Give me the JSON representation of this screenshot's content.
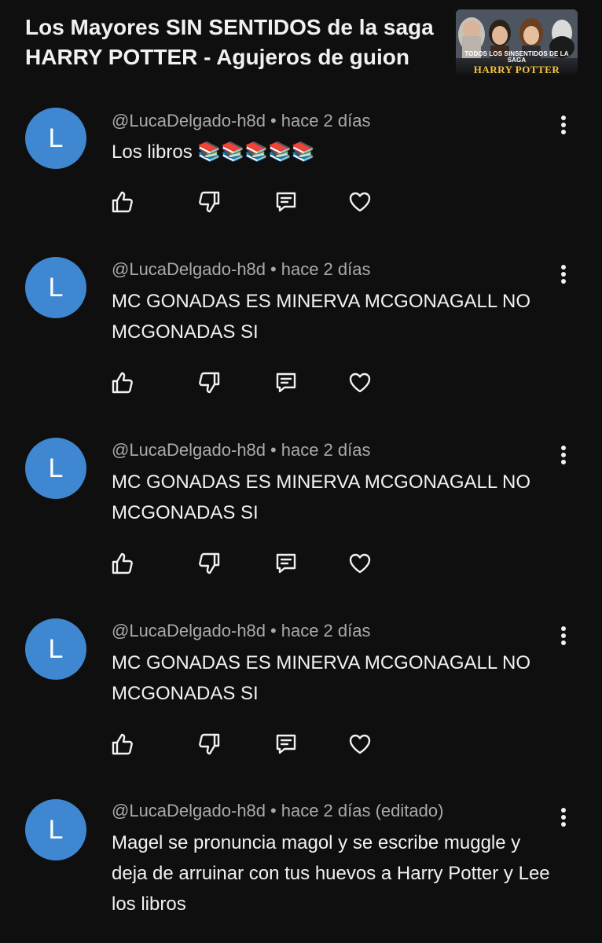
{
  "header": {
    "video_title": "Los Mayores SIN SENTIDOS de la saga HARRY POTTER - Agujeros de guion",
    "thumbnail": {
      "caption_small": "TODOS LOS SINSENTIDOS DE LA SAGA",
      "caption_big": "HARRY POTTER"
    }
  },
  "icons": {
    "like": "thumbs-up-icon",
    "dislike": "thumbs-down-icon",
    "reply": "reply-comment-icon",
    "heart": "heart-icon",
    "menu": "more-vertical-icon"
  },
  "colors": {
    "background": "#0f0f0f",
    "avatar": "#3f88d1",
    "meta_text": "#aaaaaa",
    "body_text": "#f1f1f1",
    "thumb_caption": "#f5c242"
  },
  "comments": [
    {
      "avatar_letter": "L",
      "author": "@LucaDelgado-h8d",
      "time": "hace 2 días",
      "text": "Los libros 📚📚📚📚📚"
    },
    {
      "avatar_letter": "L",
      "author": "@LucaDelgado-h8d",
      "time": "hace 2 días",
      "text": "MC GONADAS ES MINERVA MCGONAGALL NO MCGONADAS SI"
    },
    {
      "avatar_letter": "L",
      "author": "@LucaDelgado-h8d",
      "time": "hace 2 días",
      "text": "MC GONADAS ES MINERVA MCGONAGALL NO MCGONADAS SI"
    },
    {
      "avatar_letter": "L",
      "author": "@LucaDelgado-h8d",
      "time": "hace 2 días",
      "text": "MC GONADAS ES MINERVA MCGONAGALL NO MCGONADAS SI"
    },
    {
      "avatar_letter": "L",
      "author": "@LucaDelgado-h8d",
      "time": "hace 2 días (editado)",
      "text": "Magel se pronuncia magol y se escribe muggle y deja de arruinar con tus huevos a Harry Potter y Lee los libros"
    }
  ]
}
